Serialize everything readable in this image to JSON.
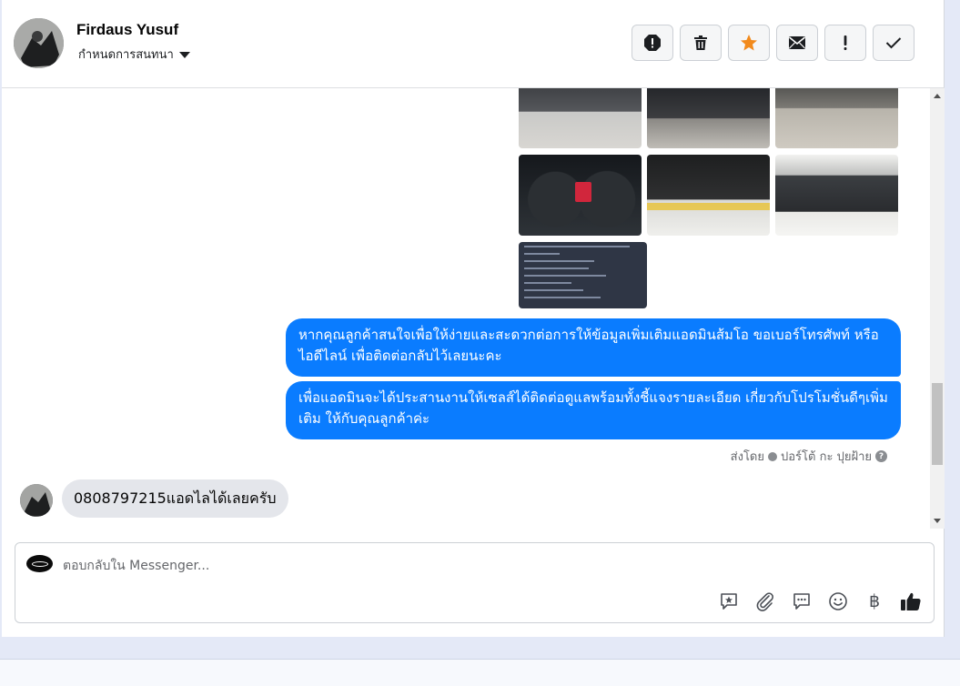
{
  "header": {
    "contact_name": "Firdaus Yusuf",
    "assign_label": "กำหนดการสนทนา"
  },
  "actions": [
    {
      "icon": "report-icon"
    },
    {
      "icon": "trash-icon"
    },
    {
      "icon": "star-icon",
      "color": "#f28a1c"
    },
    {
      "icon": "mail-icon"
    },
    {
      "icon": "exclamation-icon"
    },
    {
      "icon": "check-icon"
    }
  ],
  "messages": {
    "outgoing_1": "หากคุณลูกค้าสนใจเพื่อให้ง่ายและสะดวกต่อการให้ข้อมูลเพิ่มเติมแอดมินส้มโอ ขอเบอร์โทรศัพท์ หรือ ไอดีไลน์ เพื่อติดต่อกลับไว้เลยนะคะ",
    "outgoing_2": "เพื่อแอดมินจะได้ประสานงานให้เซลส์ได้ติดต่อดูแลพร้อมทั้งชี้แจงรายละเอียด เกี่ยวกับโปรโมชั่นดีๆเพิ่มเติม ให้กับคุณลูกค้าค่ะ",
    "sent_by_prefix": "ส่งโดย",
    "sent_by_name": "ปอร์โต้ กะ ปุยฝ้าย",
    "incoming_1": "0808797215แอดไลได้เลยครับ"
  },
  "composer": {
    "placeholder": "ตอบกลับใน Messenger...",
    "tools": [
      "saved-reply-icon",
      "attachment-icon",
      "faq-icon",
      "emoji-icon",
      "payment-icon",
      "like-icon"
    ],
    "baht_symbol": "฿"
  },
  "colors": {
    "outgoing_bubble": "#0a7cff",
    "incoming_bubble": "#e4e6eb",
    "star": "#f28a1c"
  }
}
